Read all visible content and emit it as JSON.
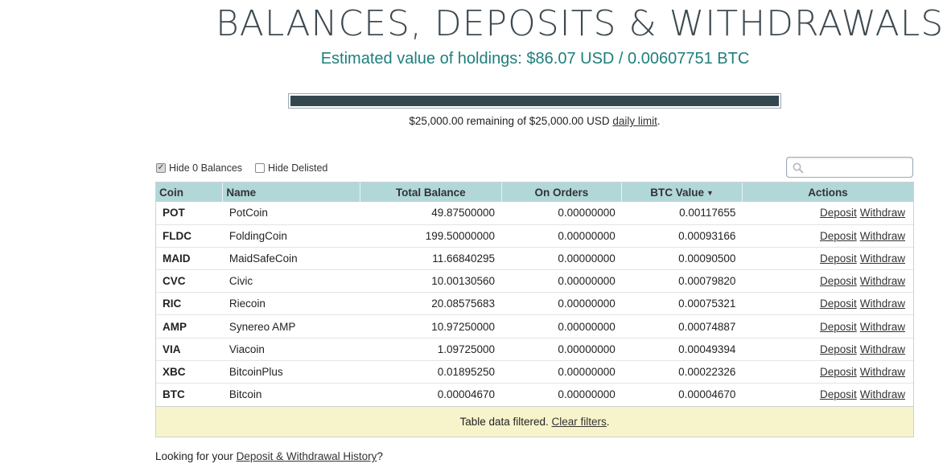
{
  "header": {
    "title": "BALANCES, DEPOSITS & WITHDRAWALS",
    "holdings": "Estimated value of holdings: $86.07 USD / 0.00607751 BTC"
  },
  "limit": {
    "used_fraction": 1.0,
    "text_before": "$25,000.00 remaining of $25,000.00 USD ",
    "link_label": "daily limit",
    "text_after": "."
  },
  "filters": {
    "hide_zero": {
      "label": "Hide 0 Balances",
      "checked": true
    },
    "hide_delisted": {
      "label": "Hide Delisted",
      "checked": false
    }
  },
  "search": {
    "placeholder": "",
    "value": ""
  },
  "table": {
    "columns": {
      "coin": "Coin",
      "name": "Name",
      "total": "Total Balance",
      "on_orders": "On Orders",
      "btc_value": "BTC Value",
      "actions": "Actions"
    },
    "sort_indicator": "▼",
    "deposit_label": "Deposit",
    "withdraw_label": "Withdraw",
    "rows": [
      {
        "coin": "POT",
        "name": "PotCoin",
        "total": "49.87500000",
        "on_orders": "0.00000000",
        "btc_value": "0.00117655"
      },
      {
        "coin": "FLDC",
        "name": "FoldingCoin",
        "total": "199.50000000",
        "on_orders": "0.00000000",
        "btc_value": "0.00093166"
      },
      {
        "coin": "MAID",
        "name": "MaidSafeCoin",
        "total": "11.66840295",
        "on_orders": "0.00000000",
        "btc_value": "0.00090500"
      },
      {
        "coin": "CVC",
        "name": "Civic",
        "total": "10.00130560",
        "on_orders": "0.00000000",
        "btc_value": "0.00079820"
      },
      {
        "coin": "RIC",
        "name": "Riecoin",
        "total": "20.08575683",
        "on_orders": "0.00000000",
        "btc_value": "0.00075321"
      },
      {
        "coin": "AMP",
        "name": "Synereo AMP",
        "total": "10.97250000",
        "on_orders": "0.00000000",
        "btc_value": "0.00074887"
      },
      {
        "coin": "VIA",
        "name": "Viacoin",
        "total": "1.09725000",
        "on_orders": "0.00000000",
        "btc_value": "0.00049394"
      },
      {
        "coin": "XBC",
        "name": "BitcoinPlus",
        "total": "0.01895250",
        "on_orders": "0.00000000",
        "btc_value": "0.00022326"
      },
      {
        "coin": "BTC",
        "name": "Bitcoin",
        "total": "0.00004670",
        "on_orders": "0.00000000",
        "btc_value": "0.00004670"
      }
    ],
    "filter_note": {
      "text": "Table data filtered. ",
      "link_label": "Clear filters",
      "after": "."
    }
  },
  "footer": {
    "text_before": "Looking for your ",
    "link_label": "Deposit & Withdrawal History",
    "text_after": "?"
  },
  "colors": {
    "header_bg": "#b2d7d9",
    "accent_teal": "#1e7f7c",
    "limit_fill": "#34474f",
    "note_bg": "#f7f3cb"
  }
}
